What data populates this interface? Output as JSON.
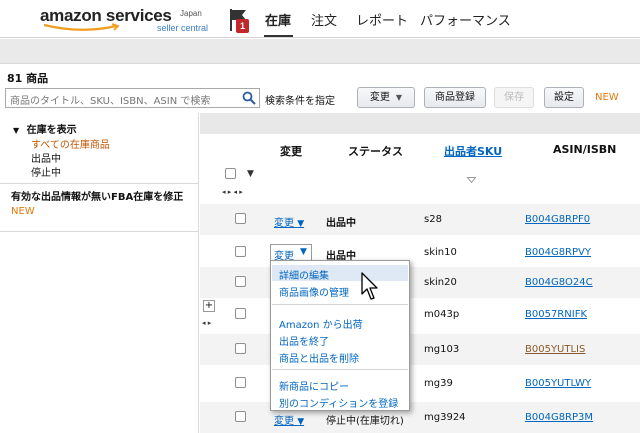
{
  "header": {
    "logo_main": "amazon services",
    "logo_region": "Japan",
    "logo_sub": "seller central",
    "notification_count": "1",
    "nav": [
      "在庫",
      "注文",
      "レポート",
      "パフォーマンス"
    ]
  },
  "toolbar": {
    "count": "81 商品",
    "search_placeholder": "商品のタイトル、SKU、ISBN、ASIN で検索",
    "advanced_search": "検索条件を指定",
    "change_btn": "変更",
    "add_product_btn": "商品登録",
    "save_btn": "保存",
    "settings_btn": "設定",
    "new_tag": "NEW"
  },
  "filters": {
    "heading": "在庫を表示",
    "items": [
      "すべての在庫商品",
      "出品中",
      "停止中"
    ],
    "fba_note": "有効な出品情報が無いFBA在庫を修正",
    "fba_new": "NEW"
  },
  "table": {
    "headers": {
      "change": "変更",
      "status": "ステータス",
      "sku": "出品者SKU",
      "asin": "ASIN/ISBN"
    },
    "rows": [
      {
        "change": "変更",
        "status": "出品中",
        "sku": "s28",
        "asin": "B004G8RPF0"
      },
      {
        "change": "変更",
        "status": "出品中",
        "sku": "skin10",
        "asin": "B004G8RPVY"
      },
      {
        "change": "",
        "status": "",
        "sku": "skin20",
        "asin": "B004G8O24C"
      },
      {
        "change": "",
        "status": "",
        "sku": "m043p",
        "asin": "B0057RNIFK"
      },
      {
        "change": "",
        "status": "",
        "sku": "mg103",
        "asin": "B005YUTLIS"
      },
      {
        "change": "",
        "status": "",
        "sku": "mg39",
        "asin": "B005YUTLWY"
      },
      {
        "change": "変更",
        "status": "停止中(在庫切れ)",
        "sku": "mg3924",
        "asin": "B004G8RP3M"
      }
    ]
  },
  "menu": {
    "items": [
      "詳細の編集",
      "商品画像の管理",
      "Amazon から出荷",
      "出品を終了",
      "商品と出品を削除",
      "新商品にコピー",
      "別のコンディションを登録"
    ]
  },
  "colors": {
    "link": "#0066c0",
    "accent_orange": "#e47911",
    "badge_red": "#c0282c"
  }
}
